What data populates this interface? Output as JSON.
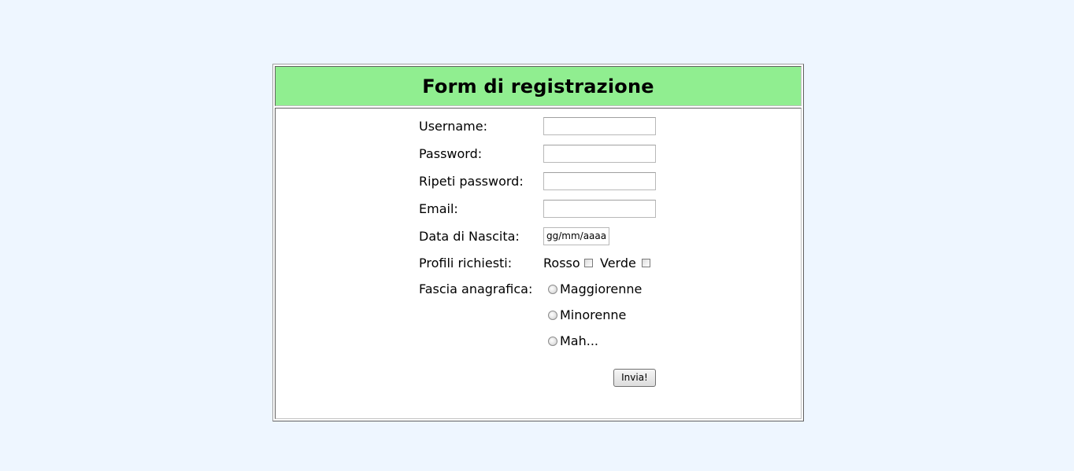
{
  "form": {
    "title": "Form di registrazione",
    "fields": {
      "username": {
        "label": "Username:",
        "value": ""
      },
      "password": {
        "label": "Password:",
        "value": ""
      },
      "repeat_password": {
        "label": "Ripeti password:",
        "value": ""
      },
      "email": {
        "label": "Email:",
        "value": ""
      },
      "birth_date": {
        "label": "Data di Nascita:",
        "placeholder": "gg/mm/aaaa"
      }
    },
    "profiles": {
      "label": "Profili richiesti:",
      "options": [
        {
          "label": "Rosso",
          "checked": false
        },
        {
          "label": "Verde",
          "checked": false
        }
      ]
    },
    "age_group": {
      "label": "Fascia anagrafica:",
      "options": [
        {
          "label": "Maggiorenne",
          "selected": false
        },
        {
          "label": "Minorenne",
          "selected": false
        },
        {
          "label": "Mah...",
          "selected": false
        }
      ]
    },
    "submit_label": "Invia!"
  },
  "colors": {
    "page_background": "#eef6ff",
    "header_background": "#90ee90",
    "form_background": "#ffffff"
  }
}
